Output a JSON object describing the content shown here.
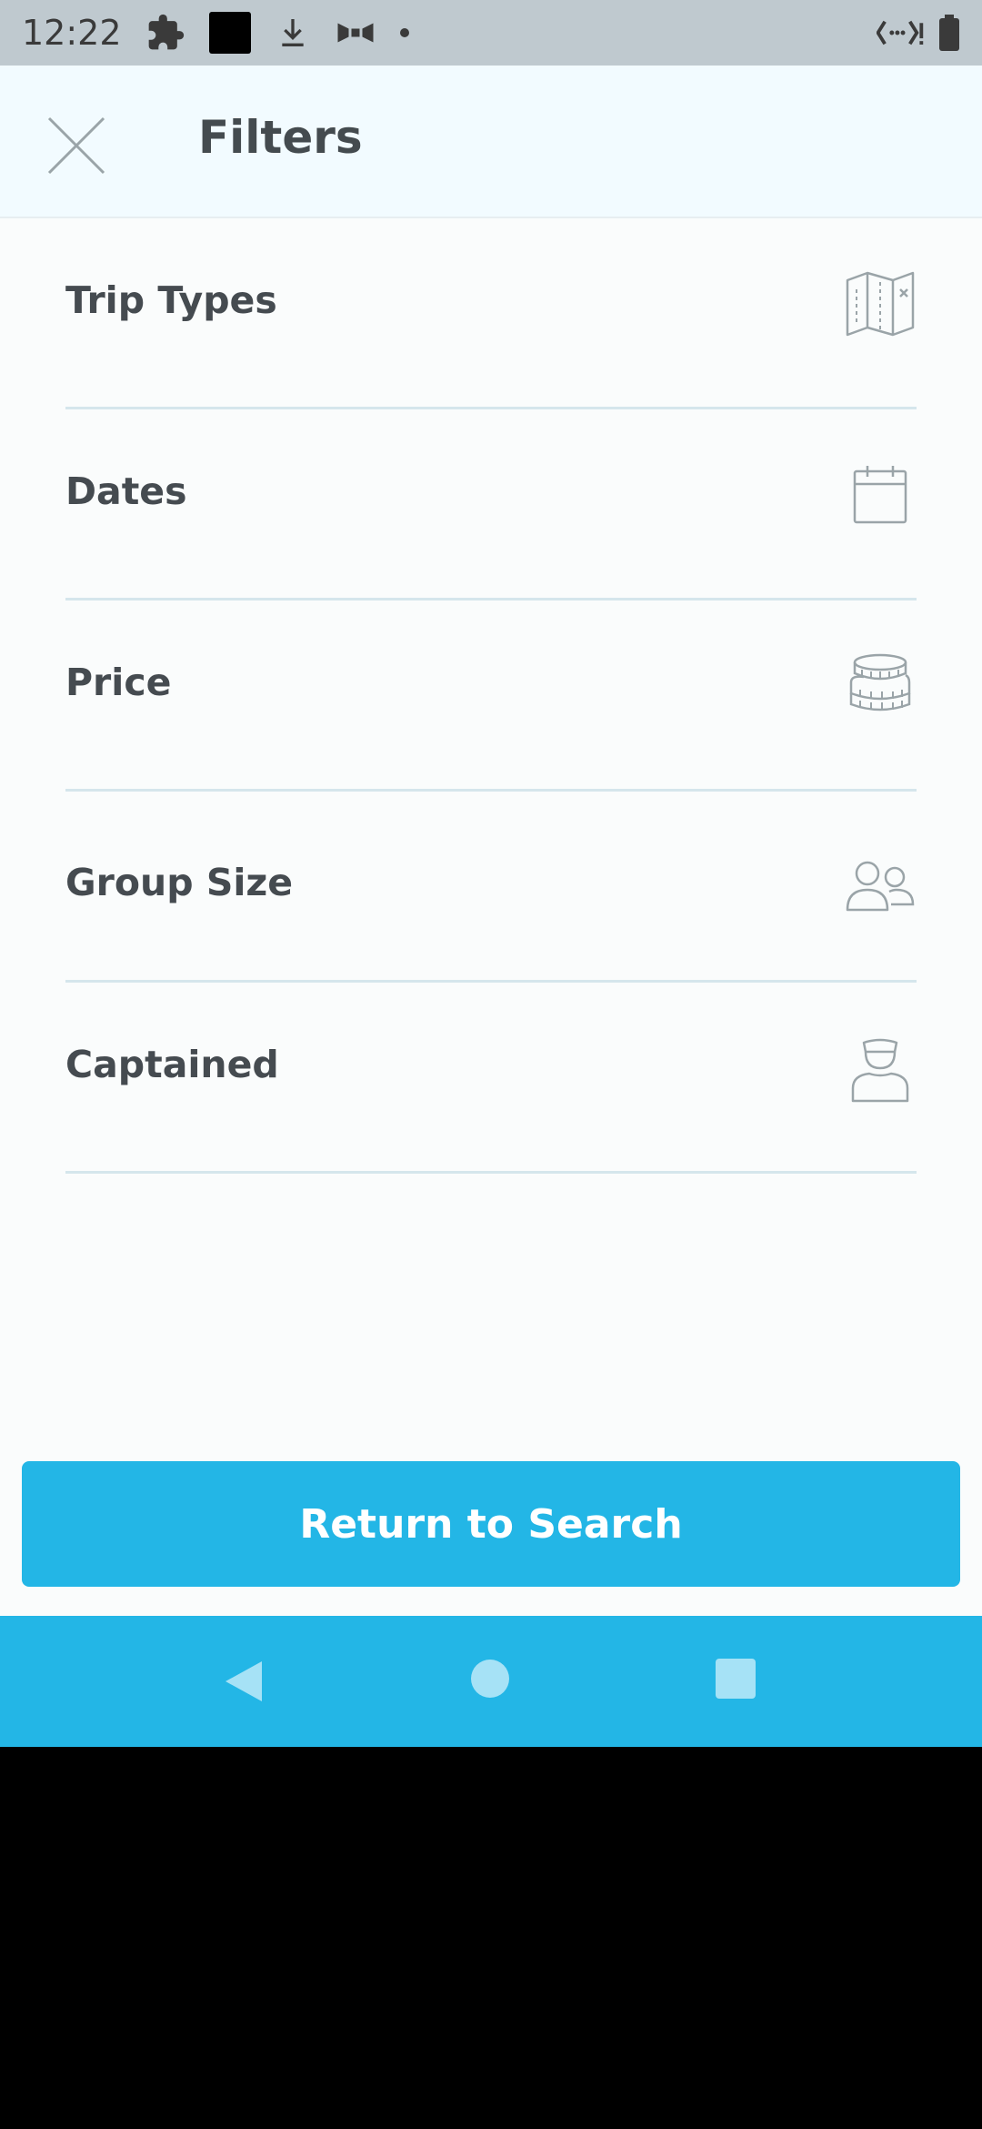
{
  "status_bar": {
    "time": "12:22"
  },
  "header": {
    "title": "Filters",
    "close_icon": "close-icon"
  },
  "filters": [
    {
      "label": "Trip Types",
      "icon": "map-icon"
    },
    {
      "label": "Dates",
      "icon": "calendar-icon"
    },
    {
      "label": "Price",
      "icon": "coins-icon"
    },
    {
      "label": "Group Size",
      "icon": "people-icon"
    },
    {
      "label": "Captained",
      "icon": "captain-icon"
    }
  ],
  "footer": {
    "button_label": "Return to Search"
  },
  "colors": {
    "accent": "#23b6e6",
    "header_bg": "#f2fbff",
    "divider": "#d5e6ec"
  }
}
